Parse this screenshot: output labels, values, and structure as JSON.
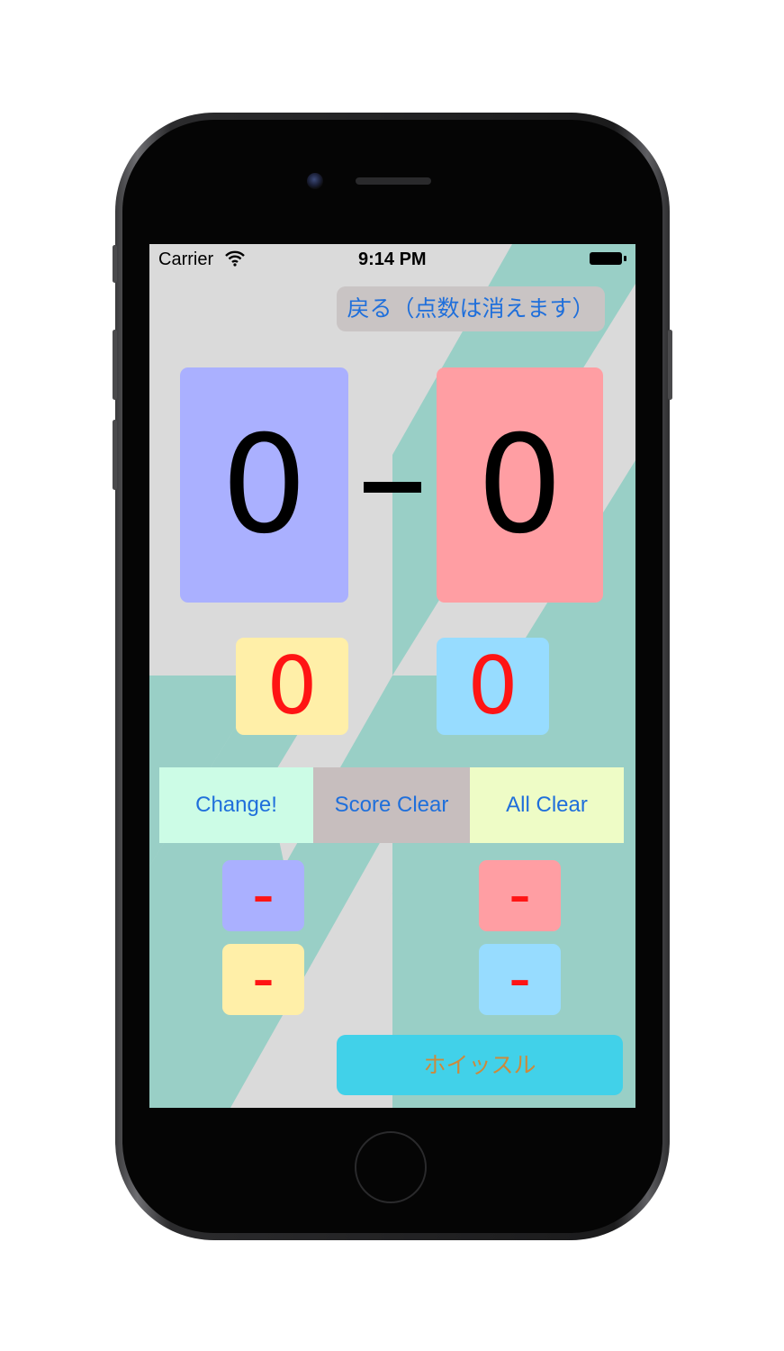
{
  "status_bar": {
    "carrier": "Carrier",
    "time": "9:14 PM"
  },
  "back_button": {
    "label": "戻る（点数は消えます）"
  },
  "scoreboard": {
    "left_score": "0",
    "separator": "–",
    "right_score": "0",
    "left_sub_score": "0",
    "right_sub_score": "0"
  },
  "actions": {
    "change": "Change!",
    "score_clear": "Score Clear",
    "all_clear": "All Clear"
  },
  "minus_buttons": {
    "left_main": "–",
    "left_sub": "–",
    "right_main": "–",
    "right_sub": "–"
  },
  "whistle_button": {
    "label": "ホイッスル"
  },
  "icons": {
    "wifi": "wifi-icon",
    "battery": "battery-icon"
  },
  "colors": {
    "background_gray": "#dadada",
    "background_teal": "#99cfc6",
    "left_team": "#aab0ff",
    "right_team": "#ff9ea3",
    "left_sub": "#ffefa8",
    "right_sub": "#97dcff",
    "change_bg": "#ccfce6",
    "score_clear_bg": "#c7bebe",
    "all_clear_bg": "#eefcc6",
    "whistle_bg": "#41d1e9",
    "whistle_text": "#cc8a3c",
    "link_blue": "#1f6fdb",
    "score_red": "#ff1414"
  }
}
